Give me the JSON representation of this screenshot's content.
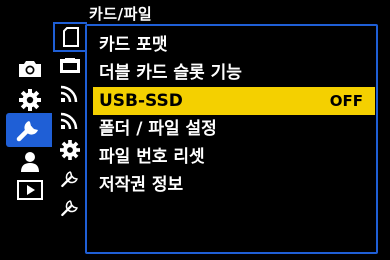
{
  "menu": {
    "title": "카드/파일"
  },
  "categories": [
    {
      "icon": "camera-icon"
    },
    {
      "icon": "gear-icon"
    },
    {
      "icon": "wrench-icon",
      "active": true
    },
    {
      "icon": "person-icon"
    },
    {
      "icon": "playback-icon"
    }
  ],
  "subtabs": [
    {
      "icon": "sd-card-icon",
      "active": true
    },
    {
      "icon": "monitor-icon"
    },
    {
      "icon": "wifi-icon"
    },
    {
      "icon": "wifi-icon"
    },
    {
      "icon": "gear-icon"
    },
    {
      "icon": "wrench-icon"
    },
    {
      "icon": "wrench-icon"
    }
  ],
  "items": [
    {
      "label": "카드 포맷",
      "value": ""
    },
    {
      "label": "더블 카드 슬롯 기능",
      "value": ""
    },
    {
      "label": "USB-SSD",
      "value": "OFF",
      "selected": true
    },
    {
      "label": "폴더 / 파일 설정",
      "value": ""
    },
    {
      "label": "파일 번호 리셋",
      "value": ""
    },
    {
      "label": "저작권 정보",
      "value": ""
    }
  ],
  "colors": {
    "accent": "#1f5fd6",
    "highlight": "#f4d000"
  }
}
